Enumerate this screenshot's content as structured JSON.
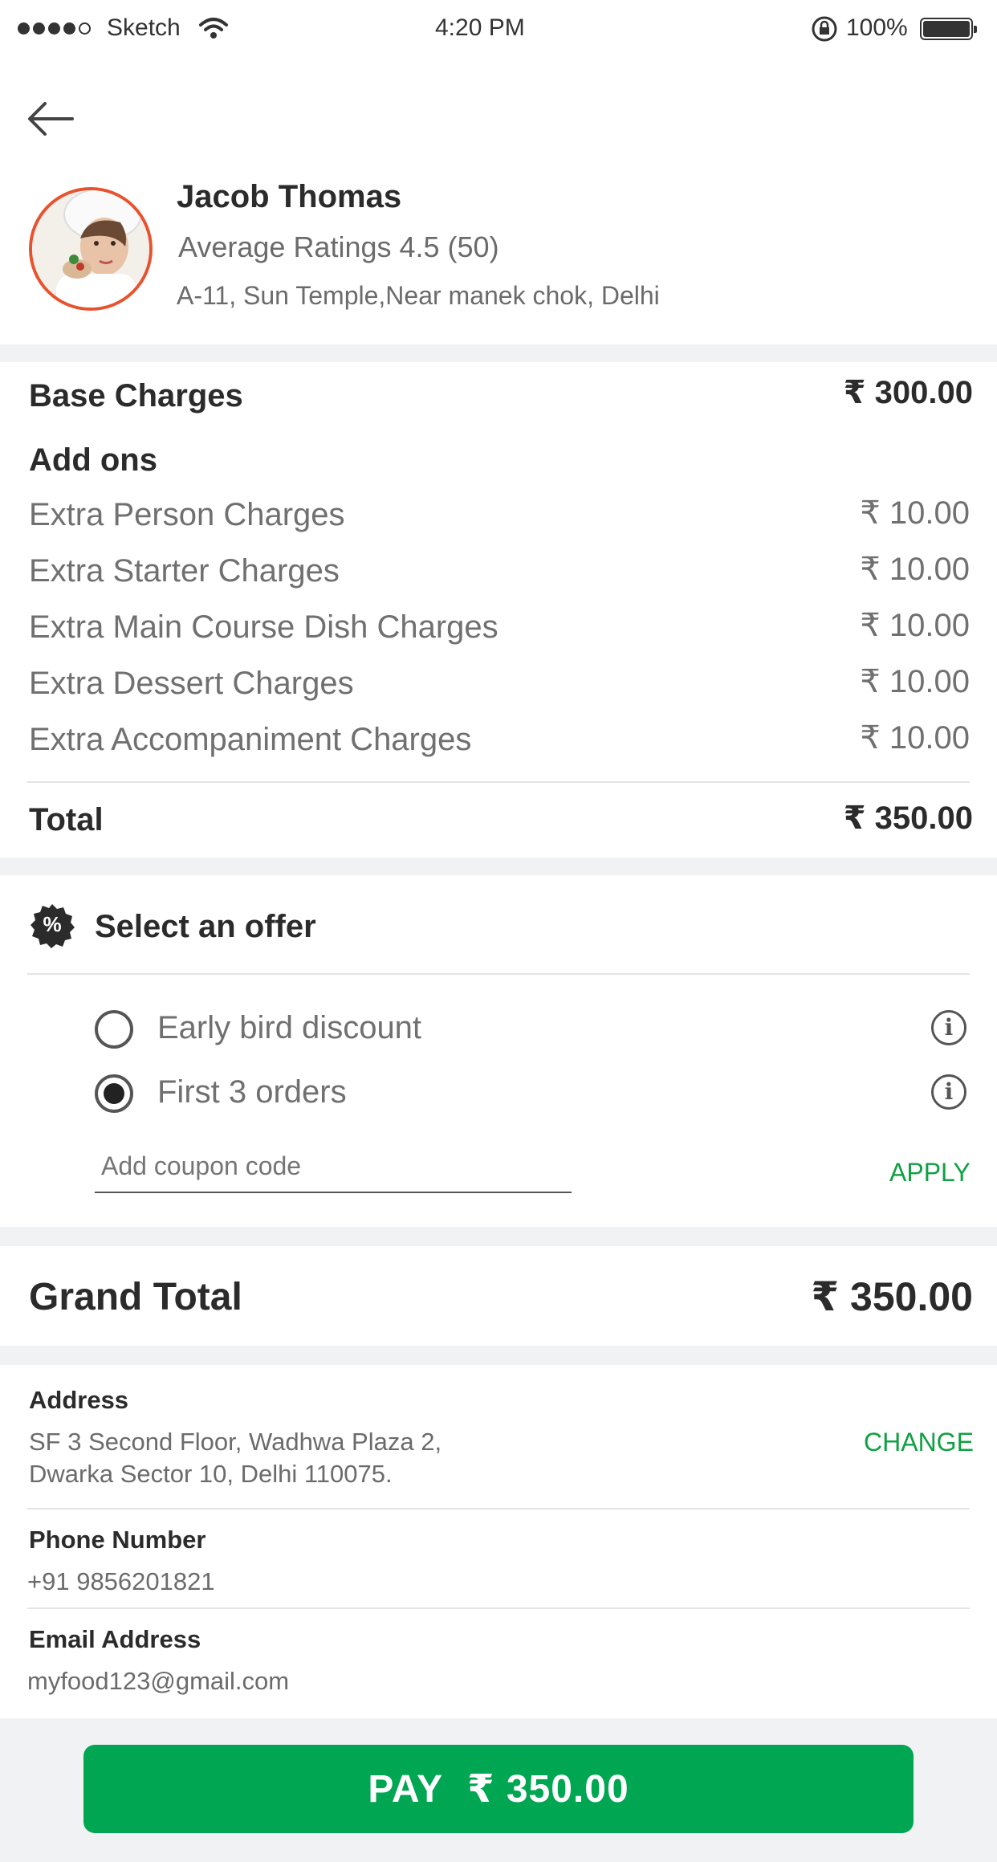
{
  "status_bar": {
    "carrier": "Sketch",
    "time": "4:20 PM",
    "battery": "100%"
  },
  "profile": {
    "name": "Jacob Thomas",
    "rating": "Average Ratings 4.5 (50)",
    "address": "A-11, Sun Temple,Near manek chok, Delhi"
  },
  "charges": {
    "base_label": "Base Charges",
    "base_value": "₹ 300.00",
    "addons_label": "Add ons",
    "addons": [
      {
        "label": "Extra Person Charges",
        "value": "₹ 10.00"
      },
      {
        "label": "Extra Starter Charges",
        "value": "₹ 10.00"
      },
      {
        "label": "Extra Main Course Dish Charges",
        "value": "₹ 10.00"
      },
      {
        "label": "Extra Dessert Charges",
        "value": "₹ 10.00"
      },
      {
        "label": "Extra Accompaniment Charges",
        "value": "₹ 10.00"
      }
    ],
    "total_label": "Total",
    "total_value": "₹ 350.00"
  },
  "offers": {
    "title": "Select an offer",
    "badge_symbol": "%",
    "options": [
      {
        "label": "Early bird discount",
        "selected": false
      },
      {
        "label": "First 3 orders",
        "selected": true
      }
    ],
    "coupon_placeholder": "Add coupon code",
    "apply_label": "APPLY"
  },
  "grand_total": {
    "label": "Grand Total",
    "value": "₹ 350.00"
  },
  "contact": {
    "address_label": "Address",
    "address_line1": "SF 3 Second Floor, Wadhwa Plaza 2,",
    "address_line2": "Dwarka Sector 10, Delhi 110075.",
    "change_label": "CHANGE",
    "phone_label": "Phone Number",
    "phone_value": "+91 9856201821",
    "email_label": "Email Address",
    "email_value": "myfood123@gmail.com"
  },
  "pay_button": {
    "label": "PAY",
    "amount": "₹ 350.00"
  },
  "colors": {
    "accent_green": "#00a651",
    "link_green": "#11a043",
    "avatar_ring": "#e8532f"
  }
}
